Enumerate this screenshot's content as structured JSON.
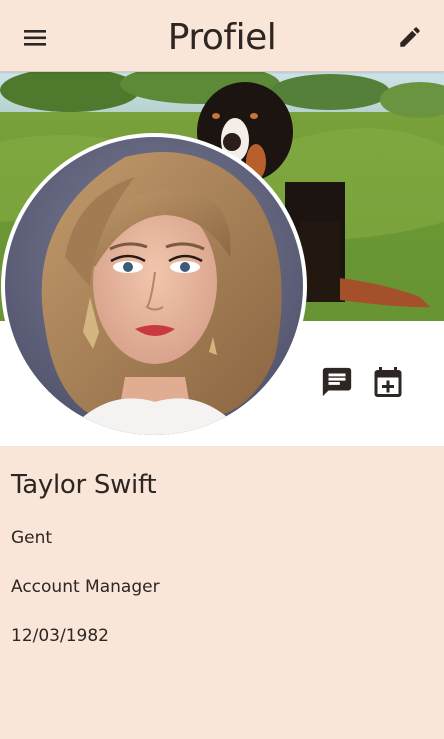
{
  "appbar": {
    "title": "Profiel",
    "menu_icon": "menu-icon",
    "edit_icon": "pencil-icon"
  },
  "profile": {
    "name": "Taylor Swift",
    "city": "Gent",
    "job_title": "Account Manager",
    "birth_date": "12/03/1982"
  },
  "actions": {
    "message_icon": "message-icon",
    "calendar_add_icon": "calendar-add-icon"
  },
  "colors": {
    "background": "#f9e6d9",
    "icon": "#2e2622",
    "white_band": "#ffffff"
  }
}
